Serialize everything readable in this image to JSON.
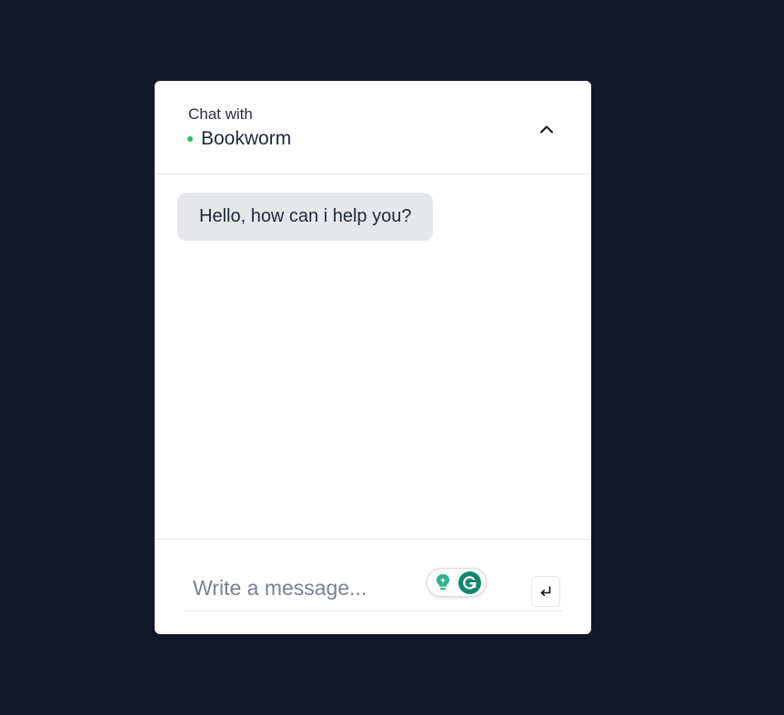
{
  "header": {
    "subtitle": "Chat with",
    "title": "Bookworm",
    "status_color": "#22c55e"
  },
  "messages": [
    {
      "sender": "bot",
      "text": "Hello, how can i help you?"
    }
  ],
  "composer": {
    "value": "",
    "placeholder": "Write a message..."
  },
  "icons": {
    "collapse": "chevron-up-icon",
    "send": "enter-return-icon",
    "extension_1": "lightbulb-icon",
    "extension_2": "grammarly-icon"
  },
  "colors": {
    "background": "#111728",
    "panel": "#ffffff",
    "bubble": "#e5e7eb",
    "accent_green": "#12876b"
  }
}
